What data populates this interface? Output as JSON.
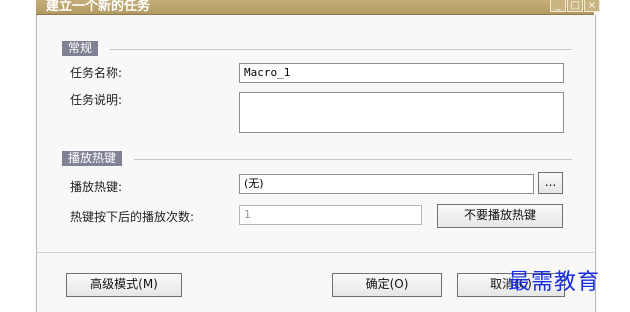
{
  "window": {
    "title": "建立一个新的任务",
    "minimize": "_",
    "maximize": "□",
    "close": "×"
  },
  "general": {
    "header": "常规",
    "task_name_label": "任务名称:",
    "task_name_value": "Macro_1",
    "task_desc_label": "任务说明:",
    "task_desc_value": ""
  },
  "hotkey": {
    "header": "播放热键",
    "hotkey_label": "播放热键:",
    "hotkey_value": "(无)",
    "browse_label": "...",
    "count_label": "热键按下后的播放次数:",
    "count_value": "1",
    "no_hotkey_button": "不要播放热键"
  },
  "footer": {
    "advanced_button": "高级模式(M)",
    "ok_button": "确定(O)",
    "cancel_button": "取消(C)"
  },
  "watermark": "最需教育"
}
